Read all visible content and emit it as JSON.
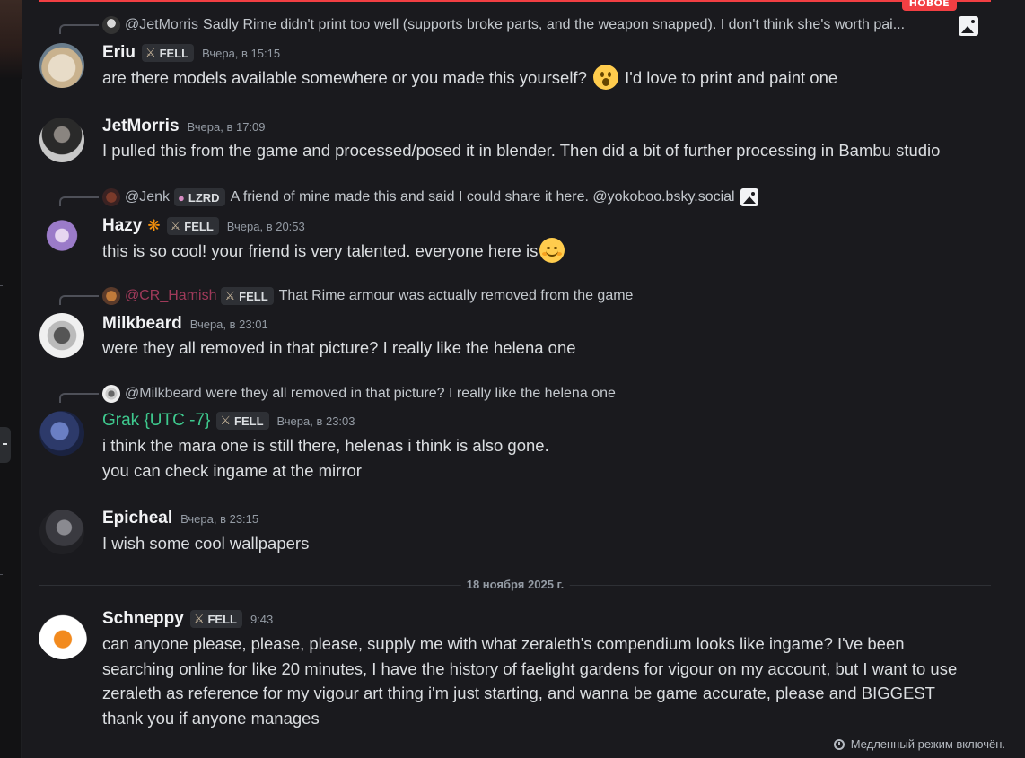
{
  "divider": {
    "new_label": "НОВОЕ"
  },
  "messages": [
    {
      "reply": {
        "name": "@JetMorris",
        "text": "Sadly Rime didn't print too well (supports broke parts, and the weapon snapped). I don't think she's worth pai...",
        "has_image_icon": true
      },
      "author": "Eriu",
      "tag": "FELL",
      "time": "Вчера, в 15:15",
      "lines": [
        "are there models available somewhere or you made this yourself?",
        "I'd love to print and paint one"
      ],
      "emoji": "hushed-face"
    },
    {
      "author": "JetMorris",
      "time": "Вчера, в 17:09",
      "lines": [
        "I pulled this from the game and processed/posed it in blender. Then did a bit of further processing in Bambu studio"
      ]
    },
    {
      "reply": {
        "name": "@Jenk",
        "tag": "LZRD",
        "text": "A friend of mine made this and said I could share it here. @yokoboo.bsky.social",
        "has_image_icon": true
      },
      "author": "Hazy",
      "author_emoji": "butterfly",
      "tag": "FELL",
      "time": "Вчера, в 20:53",
      "lines": [
        "this is so cool! your friend is very talented. everyone here is"
      ],
      "emoji": "smiling-face"
    },
    {
      "reply": {
        "name": "@CR_Hamish",
        "tag": "FELL",
        "text": "That Rime armour was actually removed from the game",
        "name_color": "#a03a5a"
      },
      "author": "Milkbeard",
      "time": "Вчера, в 23:01",
      "lines": [
        "were they all removed in that picture? I really like the helena one"
      ]
    },
    {
      "reply": {
        "name": "@Milkbeard",
        "text": "were they all removed in that picture? I really like the helena one"
      },
      "author": "Grak {UTC -7}",
      "author_color": "#3ec98e",
      "tag": "FELL",
      "time": "Вчера, в 23:03",
      "lines": [
        "i think the mara one is still there, helenas i think is also gone.",
        "you can check ingame at the mirror"
      ]
    },
    {
      "author": "Epicheal",
      "time": "Вчера, в 23:15",
      "lines": [
        "I wish some cool wallpapers"
      ]
    },
    {
      "author": "Schneppy",
      "tag": "FELL",
      "time": "9:43",
      "lines": [
        "can anyone please, please, please, supply me with what zeraleth's compendium looks like ingame? I've been searching online for like 20 minutes, I have the history of faelight gardens for vigour on my account, but I want to use zeraleth as reference for my vigour art thing i'm just starting, and wanna be game accurate, please and BIGGEST thank you if anyone manages"
      ]
    }
  ],
  "date_separator": "18 ноября 2025 г.",
  "slowmode": "Медленный режим включён.",
  "colors": {
    "background": "#1a1a1e",
    "new_red": "#f23f43",
    "grak_green": "#3ec98e"
  }
}
